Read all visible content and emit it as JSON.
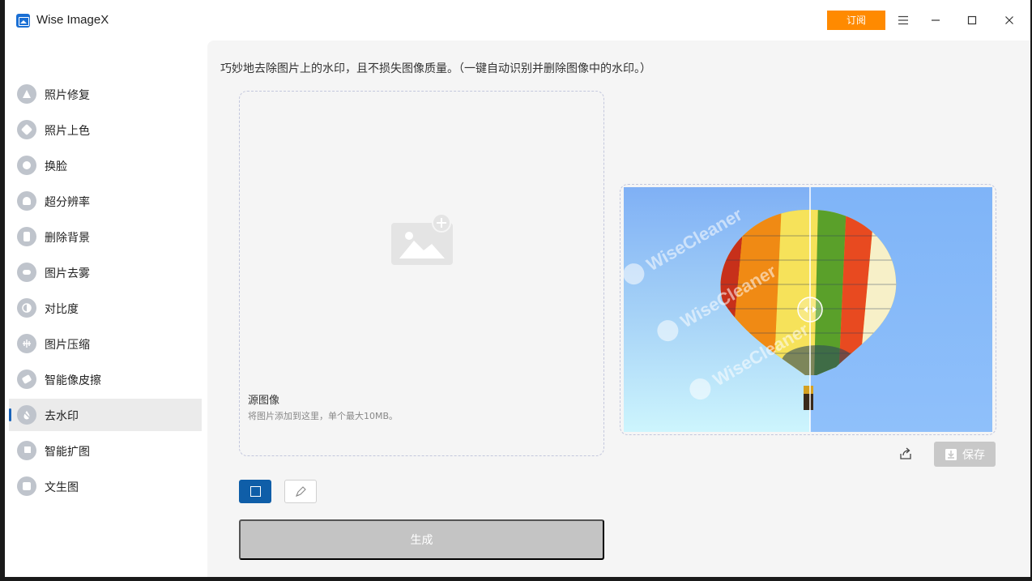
{
  "window": {
    "title": "Wise ImageX",
    "subscribe_label": "订阅"
  },
  "sidebar": {
    "items": [
      {
        "label": "照片修复",
        "icon": "photo-repair-icon"
      },
      {
        "label": "照片上色",
        "icon": "colorize-icon"
      },
      {
        "label": "换脸",
        "icon": "face-swap-icon"
      },
      {
        "label": "超分辨率",
        "icon": "super-resolution-icon"
      },
      {
        "label": "删除背景",
        "icon": "remove-background-icon"
      },
      {
        "label": "图片去雾",
        "icon": "dehaze-icon"
      },
      {
        "label": "对比度",
        "icon": "contrast-icon"
      },
      {
        "label": "图片压缩",
        "icon": "compress-icon"
      },
      {
        "label": "智能像皮擦",
        "icon": "eraser-icon"
      },
      {
        "label": "去水印",
        "icon": "watermark-remove-icon",
        "active": true
      },
      {
        "label": "智能扩图",
        "icon": "expand-icon"
      },
      {
        "label": "文生图",
        "icon": "text-to-image-icon"
      }
    ]
  },
  "main": {
    "description": "巧妙地去除图片上的水印，且不损失图像质量。（一键自动识别并删除图像中的水印。）",
    "drop_zone": {
      "title": "源图像",
      "hint": "将图片添加到这里，单个最大10MB。"
    },
    "preview": {
      "watermark_text": "WiseCleaner"
    },
    "save_label": "保存",
    "generate_label": "生成"
  },
  "colors": {
    "accent": "#ff8a00",
    "primary": "#0f5ea8",
    "active_indicator": "#1762b8"
  }
}
